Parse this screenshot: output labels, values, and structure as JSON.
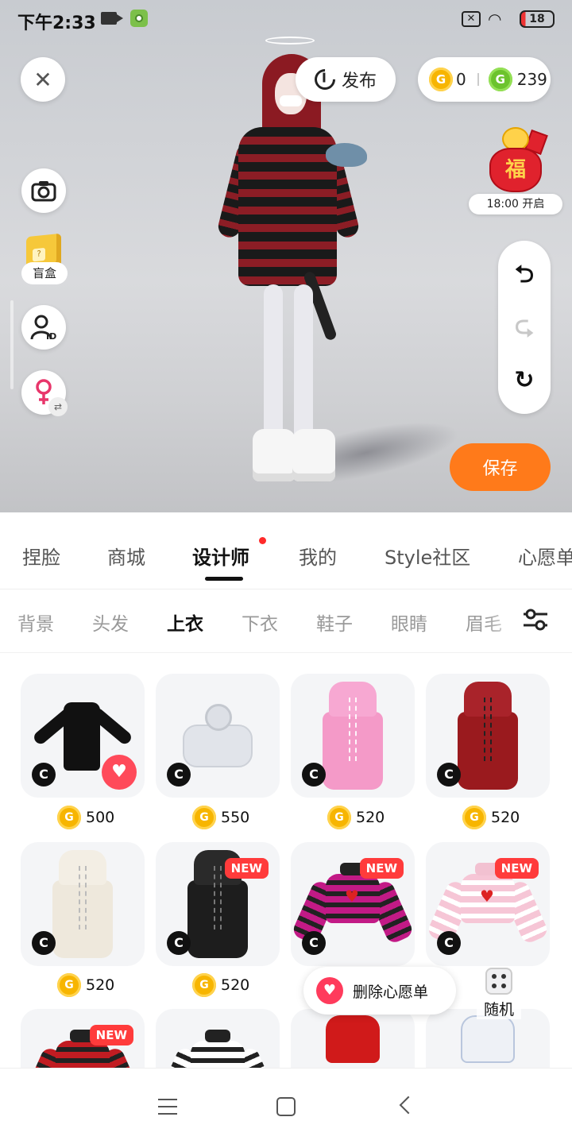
{
  "status_bar": {
    "time": "下午2:33",
    "battery": "18"
  },
  "header": {
    "publish_label": "发布",
    "gold_coins": "0",
    "green_coins": "239"
  },
  "side_tools": {
    "blind_box_label": "盲盒"
  },
  "event": {
    "time_label": "18:00 开启",
    "icon_text": "福"
  },
  "save_label": "保存",
  "main_tabs": [
    {
      "label": "捏脸",
      "active": false
    },
    {
      "label": "商城",
      "active": false
    },
    {
      "label": "设计师",
      "active": true
    },
    {
      "label": "我的",
      "active": false
    },
    {
      "label": "Style社区",
      "active": false
    },
    {
      "label": "心愿单",
      "active": false
    }
  ],
  "sub_tabs": [
    {
      "label": "背景",
      "active": false
    },
    {
      "label": "头发",
      "active": false
    },
    {
      "label": "上衣",
      "active": true
    },
    {
      "label": "下衣",
      "active": false
    },
    {
      "label": "鞋子",
      "active": false
    },
    {
      "label": "眼睛",
      "active": false
    },
    {
      "label": "眉毛",
      "active": false
    }
  ],
  "items": [
    {
      "price": "500",
      "new": false,
      "favorited": true,
      "type": "black-dress"
    },
    {
      "price": "550",
      "new": false,
      "favorited": false,
      "type": "hoodie"
    },
    {
      "price": "520",
      "new": false,
      "favorited": false,
      "type": "pink-dress"
    },
    {
      "price": "520",
      "new": false,
      "favorited": false,
      "type": "red-dress"
    },
    {
      "price": "520",
      "new": false,
      "favorited": false,
      "type": "white-dress"
    },
    {
      "price": "520",
      "new": true,
      "favorited": false,
      "type": "black-leather-dress"
    },
    {
      "price": "",
      "new": true,
      "favorited": false,
      "type": "magenta-striped-top"
    },
    {
      "price": "",
      "new": true,
      "favorited": false,
      "type": "pink-striped-top"
    }
  ],
  "badges": {
    "new_label": "NEW",
    "creator_glyph": "C",
    "coin_glyph": "G"
  },
  "overlays": {
    "wishlist_remove_label": "删除心愿单",
    "random_label": "随机"
  },
  "colors": {
    "accent": "#ff7a1a",
    "new_badge": "#ff3b3b",
    "heart": "#ff4a5a",
    "gold_coin": "#f7b500",
    "green_coin": "#6cc32d"
  }
}
